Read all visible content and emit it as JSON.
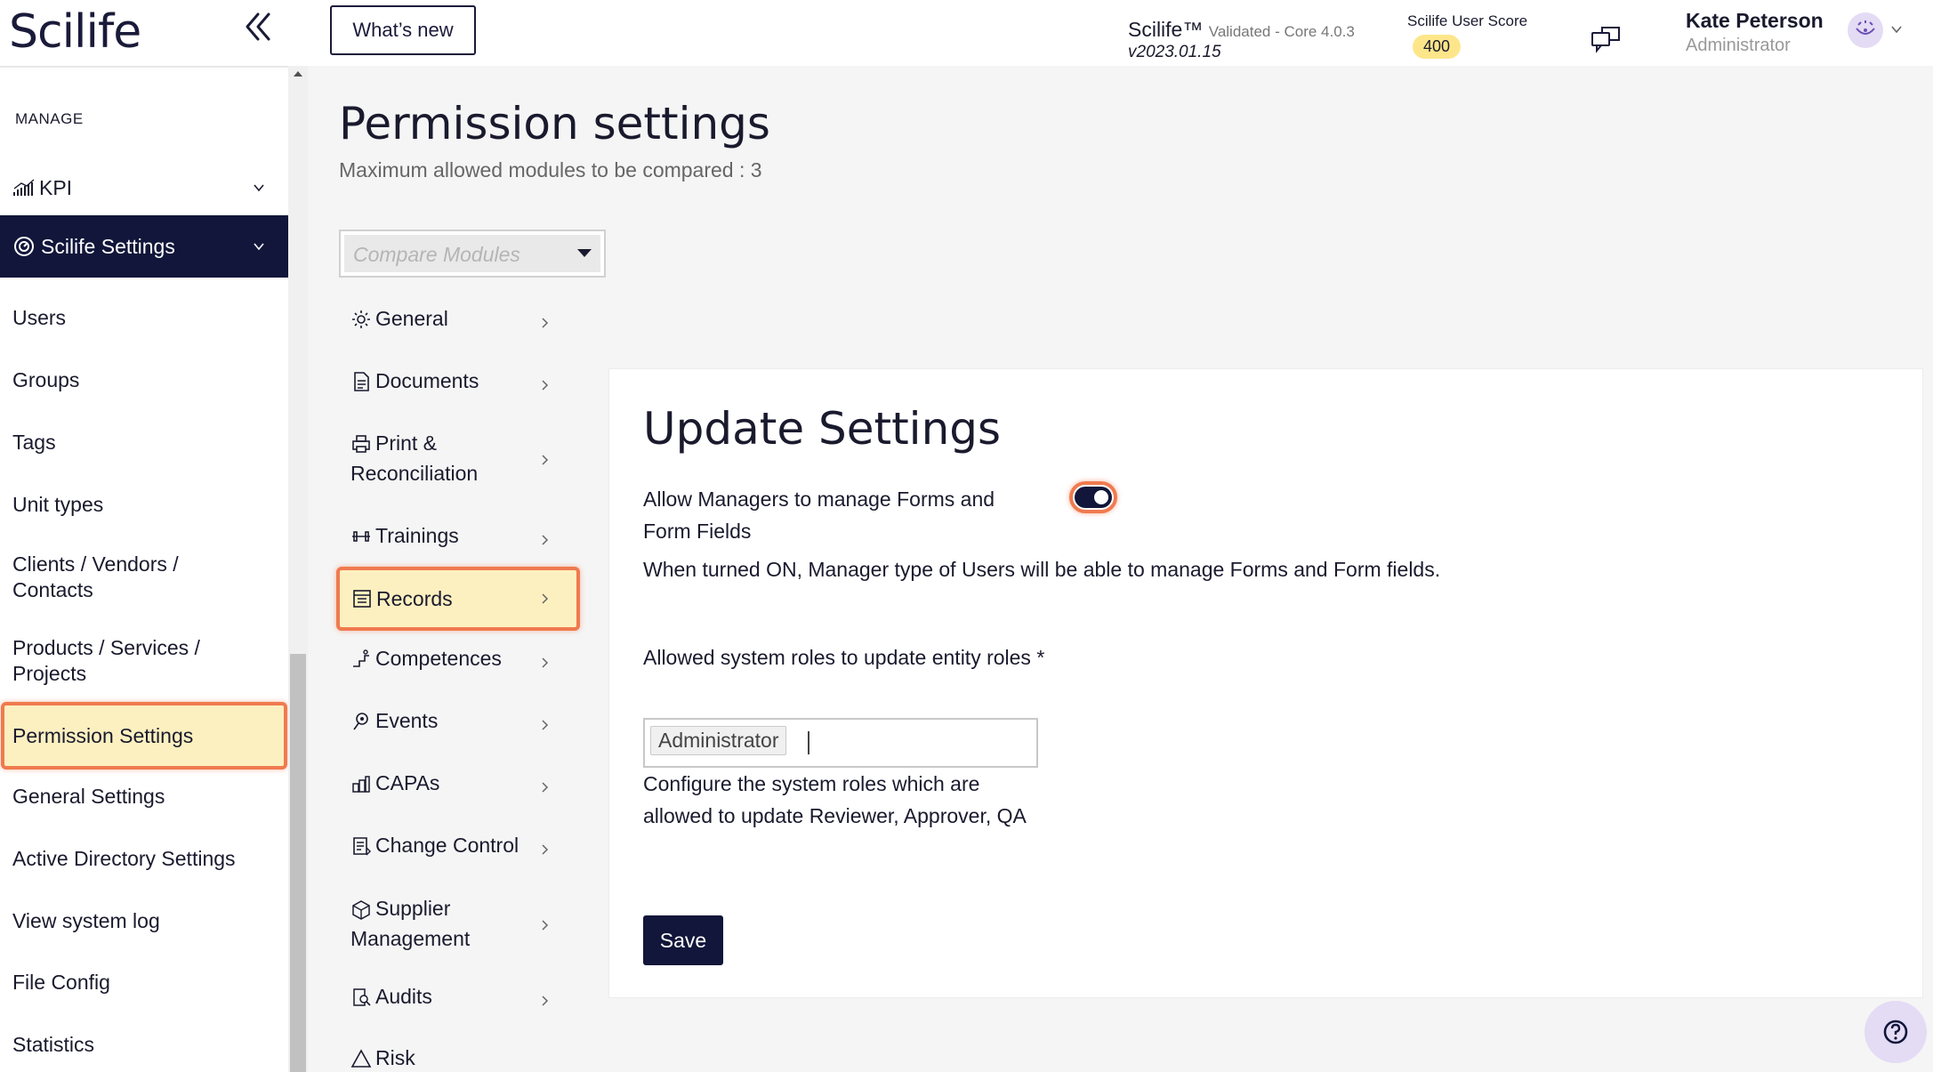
{
  "app": {
    "logo": "Scilife"
  },
  "header": {
    "whats_new_label": "What’s new",
    "product_name": "Scilife™",
    "product_sub": "Validated - Core 4.0.3",
    "version": "v2023.01.15",
    "score_label": "Scilife User Score",
    "score_value": "400",
    "user_name": "Kate Peterson",
    "user_role": "Administrator"
  },
  "sidebar": {
    "section_label": "MANAGE",
    "kpi_label": "KPI",
    "settings_label": "Scilife Settings",
    "items": [
      {
        "label": "Users"
      },
      {
        "label": "Groups"
      },
      {
        "label": "Tags"
      },
      {
        "label": "Unit types"
      },
      {
        "label": "Clients / Vendors / Contacts"
      },
      {
        "label": "Products / Services / Projects"
      },
      {
        "label": "Permission Settings",
        "active": true
      },
      {
        "label": "General Settings"
      },
      {
        "label": "Active Directory Settings"
      },
      {
        "label": "View system log"
      },
      {
        "label": "File Config"
      },
      {
        "label": "Statistics"
      }
    ]
  },
  "main": {
    "title": "Permission settings",
    "subtitle": "Maximum allowed modules to be compared : 3",
    "compare_placeholder": "Compare Modules",
    "modules": [
      {
        "label": "General",
        "icon": "gear-icon"
      },
      {
        "label": "Documents",
        "icon": "document-icon"
      },
      {
        "label": "Print & Reconciliation",
        "icon": "printer-icon"
      },
      {
        "label": "Trainings",
        "icon": "dumbbell-icon"
      },
      {
        "label": "Records",
        "icon": "records-icon",
        "active": true
      },
      {
        "label": "Competences",
        "icon": "competences-icon"
      },
      {
        "label": "Events",
        "icon": "events-icon"
      },
      {
        "label": "CAPAs",
        "icon": "capa-icon"
      },
      {
        "label": "Change Control",
        "icon": "change-control-icon"
      },
      {
        "label": "Supplier Management",
        "icon": "supplier-icon"
      },
      {
        "label": "Audits",
        "icon": "audit-icon"
      },
      {
        "label": "Risk",
        "icon": "risk-icon"
      }
    ]
  },
  "panel": {
    "title": "Update Settings",
    "option_label": "Allow Managers to manage Forms and Form Fields",
    "option_enabled": true,
    "option_description": "When turned ON, Manager type of Users will be able to manage Forms and Form fields.",
    "roles_label": "Allowed system roles to update entity roles *",
    "roles_selected": "Administrator",
    "roles_help": "Configure the system roles which are allowed to update Reviewer, Approver, QA",
    "save_label": "Save"
  },
  "colors": {
    "navy": "#11163a",
    "highlight_fill": "#fdf0c0",
    "highlight_border": "#f07a4f",
    "score_badge": "#fde68a",
    "avatar_bg": "#e4dbf5"
  }
}
